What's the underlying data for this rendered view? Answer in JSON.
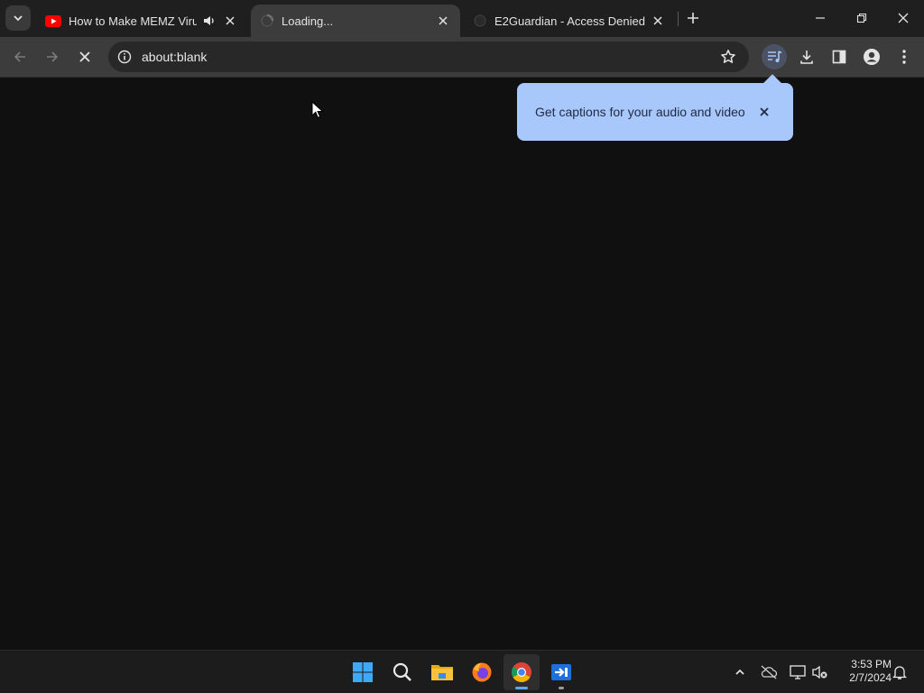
{
  "tabs": [
    {
      "title": "How to Make MEMZ Virus (",
      "icon": "youtube-icon"
    },
    {
      "title": "Loading...",
      "icon": "loading-spinner-icon"
    },
    {
      "title": "E2Guardian - Access Denied",
      "icon": "globe-icon"
    }
  ],
  "toolbar": {
    "url": "about:blank"
  },
  "captions_bubble": {
    "text": "Get captions for your audio and video"
  },
  "taskbar": {
    "apps": [
      "windows-start-icon",
      "search-icon",
      "file-explorer-icon",
      "firefox-icon",
      "chrome-icon",
      "remote-app-icon"
    ],
    "time": "3:53 PM",
    "date": "2/7/2024"
  },
  "colors": {
    "accent": "#a8c7fa",
    "tabstrip": "#1f1f1f",
    "toolbar": "#3c3c3c",
    "page": "#101010"
  }
}
